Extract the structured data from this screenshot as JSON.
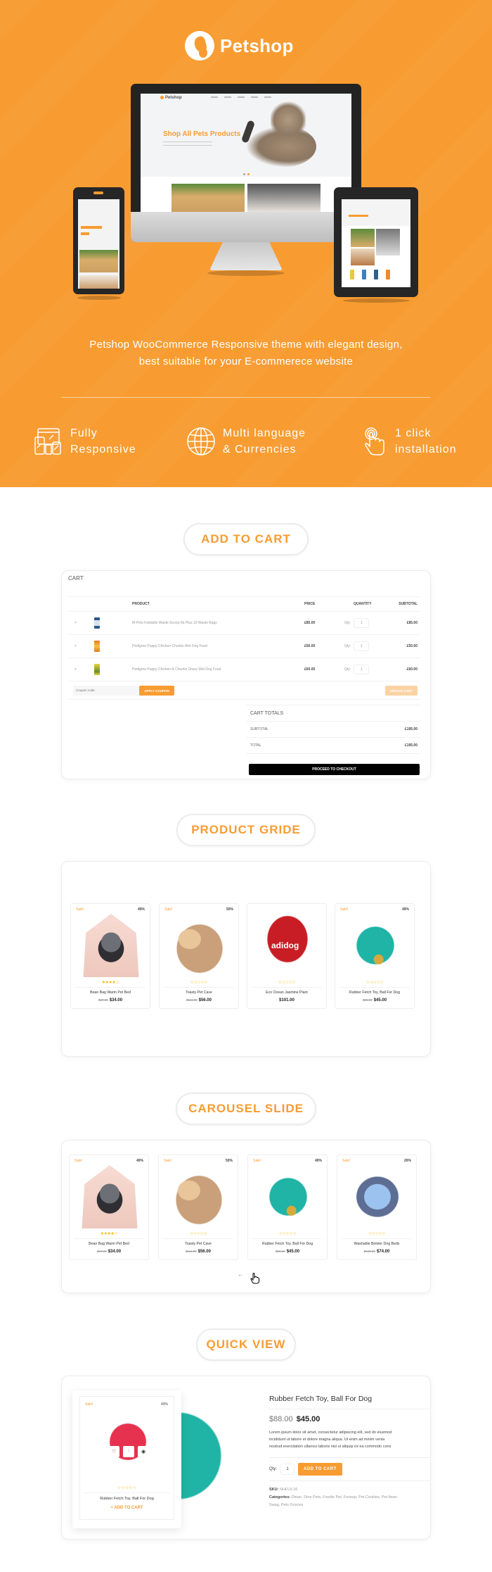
{
  "hero": {
    "brand": "Petshop",
    "device_screen": {
      "headline": "Shop All Pets Products"
    },
    "tagline_line1": "Petshop WooCommerce Responsive theme with elegant design,",
    "tagline_line2": "best suitable for your E-commerece website",
    "features": [
      {
        "icon": "responsive-devices-icon",
        "line1": "Fully",
        "line2": "Responsive"
      },
      {
        "icon": "globe-icon",
        "line1": "Multi language",
        "line2": "& Currencies"
      },
      {
        "icon": "tap-hand-icon",
        "line1": "1 click",
        "line2": "installation"
      }
    ],
    "colors": {
      "accent": "#f89c31"
    }
  },
  "sections": {
    "add_to_cart": "ADD TO CART",
    "product_grid": "PRODUCT GRIDE",
    "carousel": "CAROUSEL SLIDE",
    "quick_view": "QUICK VIEW"
  },
  "cart": {
    "title": "CART",
    "headers": {
      "product": "PRODUCT",
      "price": "PRICE",
      "quantity": "QUANTITY",
      "subtotal": "SUBTOTAL"
    },
    "remove_glyph": "×",
    "qty_label": "Qty:",
    "rows": [
      {
        "name": "M-Pets Foldable Waste Scoop Kit Plus 10 Waste Bags",
        "price": "£85.00",
        "qty": "1",
        "subtotal": "£85.00"
      },
      {
        "name": "Pedigree Puppy Chicken Chunks Wet Dog Food",
        "price": "£50.00",
        "qty": "1",
        "subtotal": "£50.00"
      },
      {
        "name": "Pedigree Puppy Chicken & Chunks Gravy Wet Dog Food",
        "price": "£60.00",
        "qty": "1",
        "subtotal": "£60.00"
      }
    ],
    "coupon_placeholder": "Coupon code",
    "apply_coupon": "APPLY COUPON",
    "update_cart": "UPDATE CART",
    "totals": {
      "title": "CART TOTALS",
      "subtotal_label": "SUBTOTAL",
      "subtotal": "£195.00",
      "total_label": "TOTAL",
      "total": "£195.00",
      "checkout": "PROCEED TO CHECKOUT"
    }
  },
  "product_grid": [
    {
      "sale": "Sale!",
      "pct": "49%",
      "stars": "★★★★☆",
      "name": "Bean Bag Warm Pet Bed",
      "old": "$67.00",
      "price": "$34.00"
    },
    {
      "sale": "Sale!",
      "pct": "50%",
      "stars": "☆☆☆☆☆",
      "name": "Toasty Pet Cave",
      "old": "$111.00",
      "price": "$56.00"
    },
    {
      "sale": "",
      "pct": "",
      "stars": "☆☆☆☆☆",
      "name": "Eco Ocean Jasmine Plant",
      "old": "",
      "price": "$101.00"
    },
    {
      "sale": "Sale!",
      "pct": "49%",
      "stars": "☆☆☆☆☆",
      "name": "Rubber Fetch Toy, Ball For Dog",
      "old": "$88.00",
      "price": "$45.00"
    }
  ],
  "carousel": {
    "items": [
      {
        "sale": "Sale!",
        "pct": "49%",
        "stars": "★★★★☆",
        "name": "Bean Bag Warm Pet Bed",
        "old": "$67.00",
        "price": "$34.00"
      },
      {
        "sale": "Sale!",
        "pct": "50%",
        "stars": "☆☆☆☆☆",
        "name": "Toasty Pet Cave",
        "old": "$111.00",
        "price": "$56.00"
      },
      {
        "sale": "Sale!",
        "pct": "49%",
        "stars": "☆☆☆☆☆",
        "name": "Rubber Fetch Toy, Ball For Dog",
        "old": "$88.00",
        "price": "$45.00"
      },
      {
        "sale": "Sale!",
        "pct": "26%",
        "stars": "☆☆☆☆☆",
        "name": "Washable Bolster Dog Beds",
        "old": "$100.00",
        "price": "$74.00"
      }
    ],
    "prev_arrow": "←"
  },
  "quick_view": {
    "card": {
      "sale": "Sale!",
      "pct": "49%",
      "stars": "☆☆☆☆☆",
      "name": "Rubber Fetch Toy, Ball For Dog",
      "add_to_cart": "+ ADD TO CART"
    },
    "actions": [
      "heart-icon",
      "compare-icon",
      "eye-icon"
    ],
    "title": "Rubber Fetch Toy, Ball For Dog",
    "old_price": "$88.00",
    "price": "$45.00",
    "description_lines": [
      "Lorem ipsum dolor sit amet, consectetur adipiscing elit, sed do eiusmod",
      "incididunt ut labore et dolore magna aliqua. Ut enim ad minim venia",
      "nostrud exercitation ullamco laboris nisi ut aliquip ex ea commodo cons"
    ],
    "qty_label": "Qty:",
    "qty": "1",
    "add_to_cart": "ADD TO CART",
    "sku_label": "SKU:",
    "sku": "NHFL5-16",
    "categories_label": "Categories:",
    "categories_line1": "Diean, Dine Pets, Foodie Pet, Foxoup, Pet Cookies, Pet Itean",
    "categories_line2": "Swag, Pets Grocies"
  }
}
